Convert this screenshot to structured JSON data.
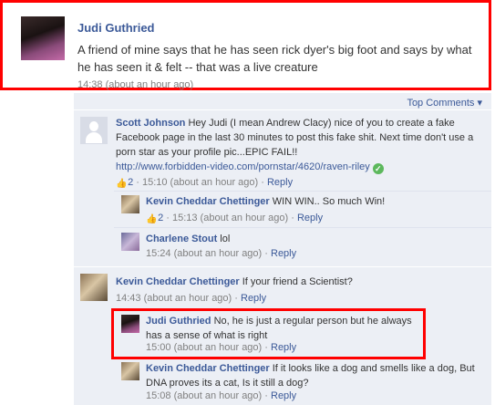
{
  "post": {
    "author": "Judi Guthried",
    "text": "A friend of mine says that he has seen rick dyer's big foot and says by what he has seen it & felt -- that was a live creature",
    "time": "14:38 (about an hour ago)"
  },
  "top_comments_label": "Top Comments ▾",
  "comments": [
    {
      "author": "Scott Johnson",
      "text": "Hey Judi (I mean Andrew Clacy) nice of you to create a fake Facebook page in the last 30 minutes to post this fake shit. Next time don't use a porn star as your profile pic...EPIC FAIL!!",
      "link": "http://www.forbidden-video.com/pornstar/4620/raven-riley",
      "likes": "2",
      "time": "15:10 (about an hour ago)",
      "reply": "Reply",
      "replies": [
        {
          "author": "Kevin Cheddar Chettinger",
          "text": "WIN WIN.. So much Win!",
          "likes": "2",
          "time": "15:13 (about an hour ago)",
          "reply": "Reply"
        },
        {
          "author": "Charlene Stout",
          "text": "lol",
          "time": "15:24 (about an hour ago)",
          "reply": "Reply"
        }
      ]
    },
    {
      "author": "Kevin Cheddar Chettinger",
      "text": "If your friend a Scientist?",
      "time": "14:43 (about an hour ago)",
      "reply": "Reply",
      "replies": [
        {
          "author": "Judi Guthried",
          "text": "No, he is just a regular person but he always has a sense of what is right",
          "time": "15:00 (about an hour ago)",
          "reply": "Reply"
        },
        {
          "author": "Kevin Cheddar Chettinger",
          "text": "If it looks like a dog and smells like a dog, But DNA proves its a cat, Is it still a dog?",
          "time": "15:08 (about an hour ago)",
          "reply": "Reply"
        }
      ]
    }
  ],
  "colors": {
    "link": "#3b5998",
    "highlight": "#ff0000",
    "comment_bg": "#eceff5"
  },
  "icons": {
    "like": "thumbs-up-icon",
    "verified": "check-icon"
  }
}
